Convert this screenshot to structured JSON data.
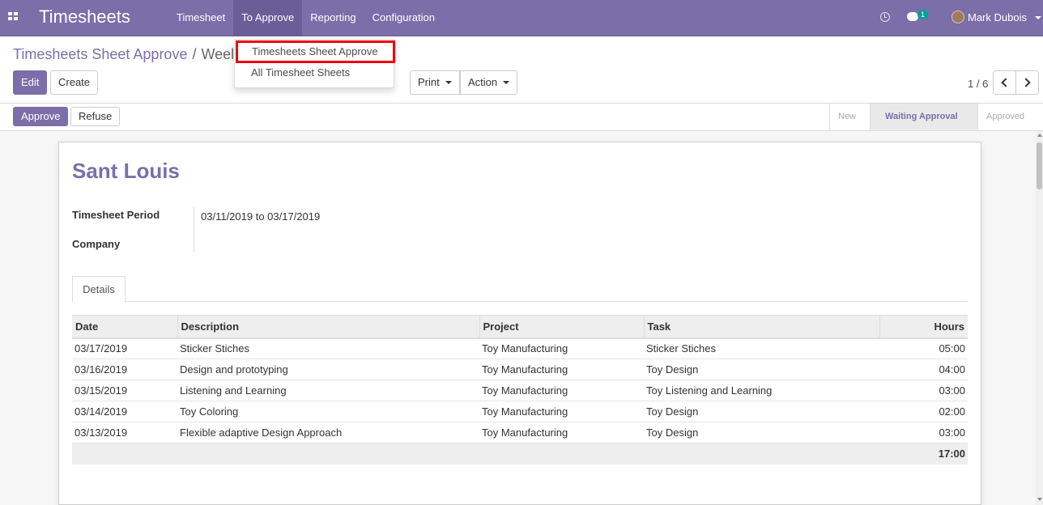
{
  "navbar": {
    "brand": "Timesheets",
    "menu": [
      {
        "label": "Timesheet"
      },
      {
        "label": "To Approve"
      },
      {
        "label": "Reporting"
      },
      {
        "label": "Configuration"
      }
    ],
    "chat_count": "1",
    "user_name": "Mark Dubois",
    "accent_color": "#7c6ea9"
  },
  "dropdown": {
    "items": [
      {
        "label": "Timesheets Sheet Approve"
      },
      {
        "label": "All Timesheet Sheets"
      }
    ]
  },
  "breadcrumb": {
    "parent": "Timesheets Sheet Approve",
    "separator": "/",
    "current": "Weel"
  },
  "buttons": {
    "edit": "Edit",
    "create": "Create",
    "print": "Print",
    "action": "Action",
    "approve": "Approve",
    "refuse": "Refuse"
  },
  "pager": {
    "value": "1 / 6"
  },
  "status": {
    "stages": [
      "New",
      "Waiting Approval",
      "Approved"
    ],
    "active": "Waiting Approval"
  },
  "form": {
    "title": "Sant Louis",
    "fields": {
      "period_label": "Timesheet Period",
      "period_value": "03/11/2019 to 03/17/2019",
      "company_label": "Company",
      "company_value": ""
    },
    "tab_label": "Details"
  },
  "table": {
    "columns": [
      "Date",
      "Description",
      "Project",
      "Task",
      "Hours"
    ],
    "rows": [
      [
        "03/17/2019",
        "Sticker Stiches",
        "Toy Manufacturing",
        "Sticker Stiches",
        "05:00"
      ],
      [
        "03/16/2019",
        "Design and prototyping",
        "Toy Manufacturing",
        "Toy Design",
        "04:00"
      ],
      [
        "03/15/2019",
        "Listening and Learning",
        "Toy Manufacturing",
        "Toy Listening and Learning",
        "03:00"
      ],
      [
        "03/14/2019",
        "Toy Coloring",
        "Toy Manufacturing",
        "Toy Design",
        "02:00"
      ],
      [
        "03/13/2019",
        "Flexible adaptive Design Approach",
        "Toy Manufacturing",
        "Toy Design",
        "03:00"
      ]
    ],
    "total": "17:00"
  }
}
